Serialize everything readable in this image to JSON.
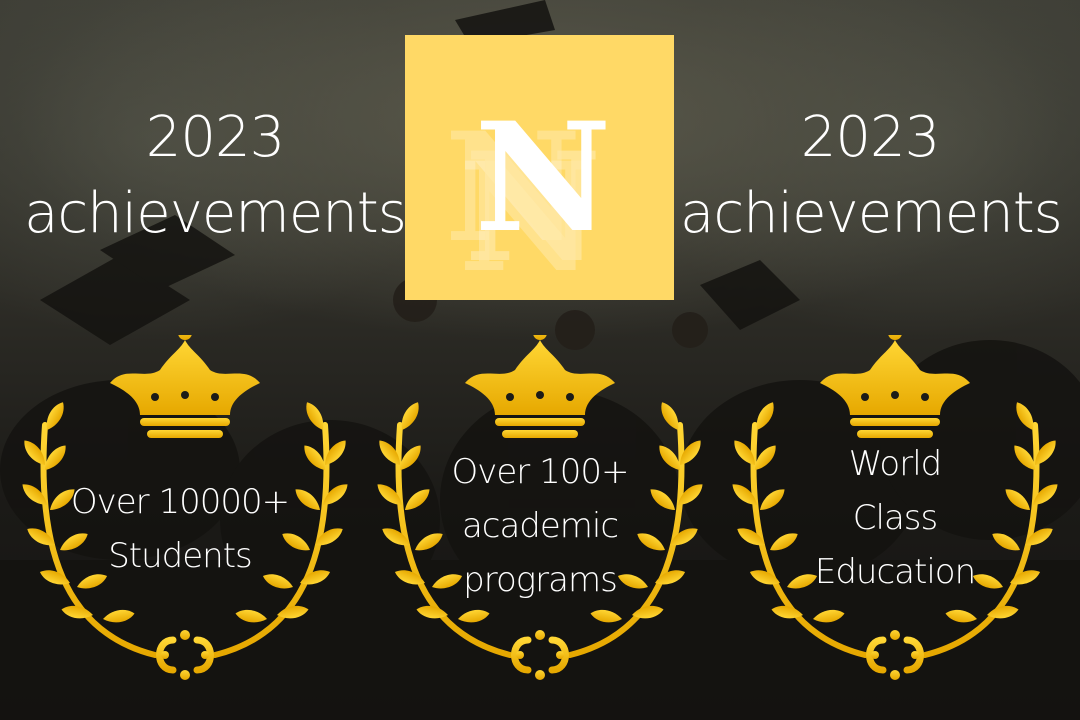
{
  "background": {
    "description_color": "#2e2d27",
    "accent": "#ffd966",
    "gold": "#f2c200"
  },
  "header": {
    "left_title_line1": "2023",
    "left_title_line2": "achievements",
    "right_title_line1": "2023",
    "right_title_line2": "achievements"
  },
  "logo": {
    "letter": "N",
    "icon": "n-monogram-logo"
  },
  "awards": [
    {
      "icon": "crown-laurel-icon",
      "line1": "Over 10000+",
      "line2": "Students"
    },
    {
      "icon": "crown-laurel-icon",
      "line1": "Over 100+",
      "line2": "academic",
      "line3": "programs"
    },
    {
      "icon": "crown-laurel-icon",
      "line1": "World",
      "line2": "Class",
      "line3": "Education"
    }
  ]
}
